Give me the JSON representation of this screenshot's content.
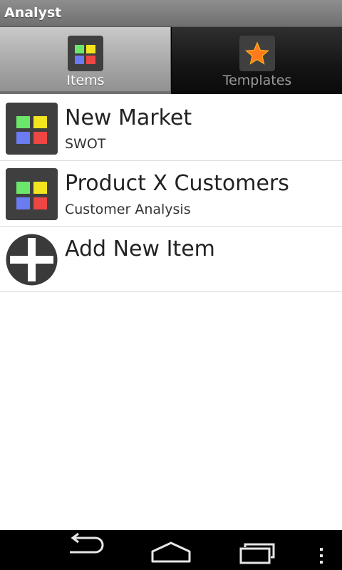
{
  "app": {
    "title": "Analyst"
  },
  "tabs": [
    {
      "label": "Items",
      "icon": "grid-icon",
      "active": true
    },
    {
      "label": "Templates",
      "icon": "star-icon",
      "active": false
    }
  ],
  "items": [
    {
      "title": "New Market",
      "subtitle": "SWOT",
      "icon": "grid-icon"
    },
    {
      "title": "Product X Customers",
      "subtitle": "Customer Analysis",
      "icon": "grid-icon"
    },
    {
      "title": "Add New Item",
      "subtitle": "",
      "icon": "plus-circle-icon"
    }
  ],
  "nav": {
    "back": "back-icon",
    "home": "home-icon",
    "recents": "recents-icon",
    "menu": "menu-icon"
  },
  "colors": {
    "grid_green": "#6be66b",
    "grid_yellow": "#f2e51e",
    "grid_blue": "#6b7bf0",
    "grid_red": "#ee4545",
    "icon_bg": "#3f3f3f",
    "star": "#ff7a1a"
  }
}
